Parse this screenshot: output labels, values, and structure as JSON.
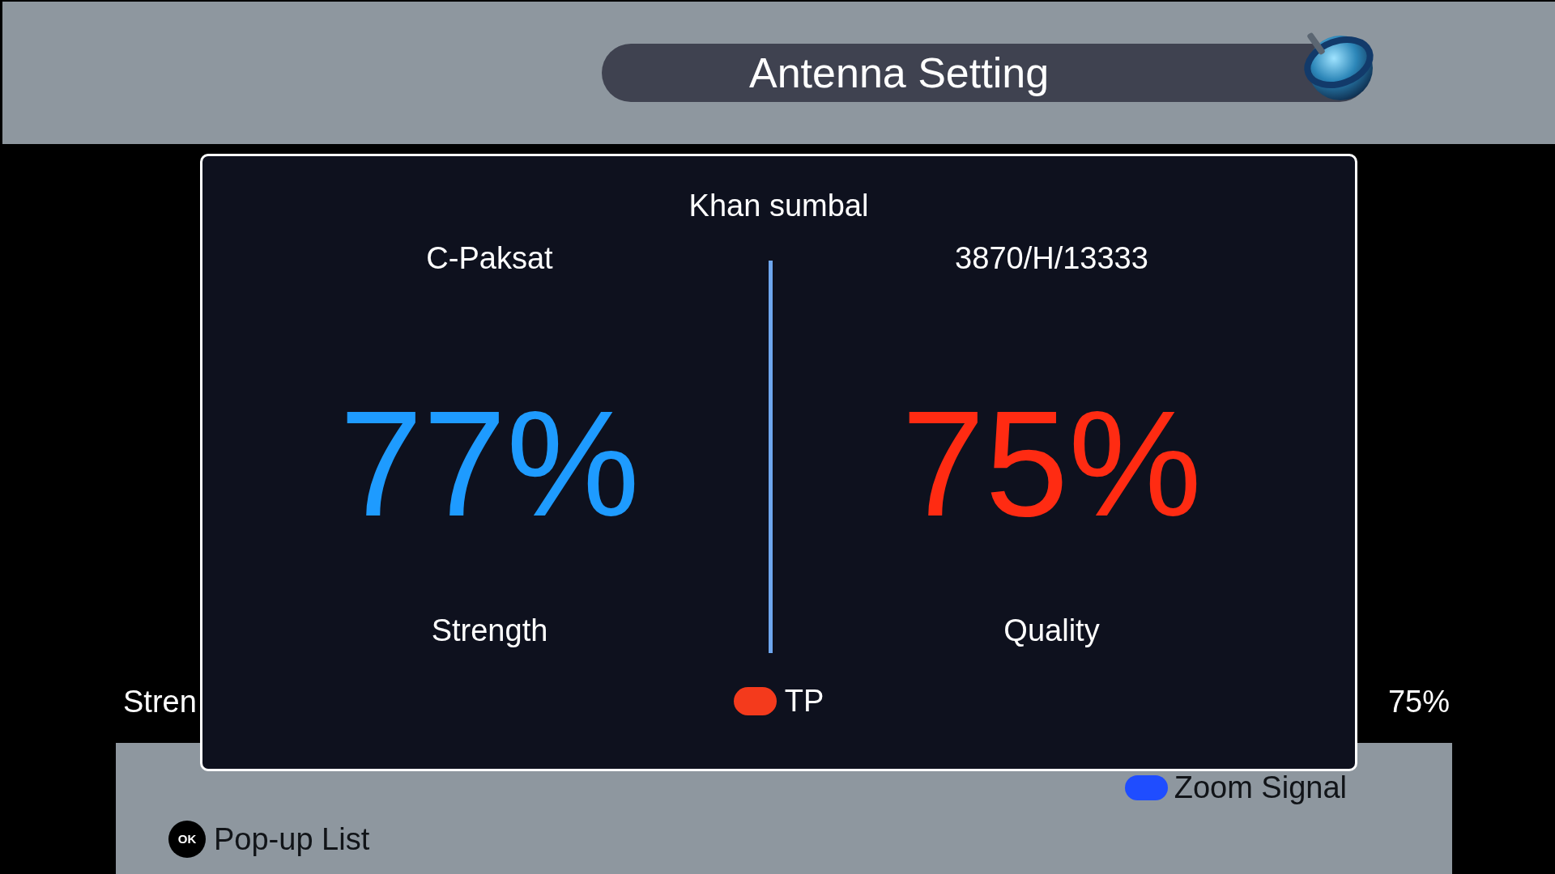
{
  "header": {
    "title": "Antenna Setting"
  },
  "background_row": {
    "label": "Stren",
    "reading": "75%"
  },
  "modal": {
    "title": "Khan sumbal",
    "meters": [
      {
        "caption": "C-Paksat",
        "value": "77%",
        "label": "Strength",
        "color": "#1e9bff"
      },
      {
        "caption": "3870/H/13333",
        "value": "75%",
        "label": "Quality",
        "color": "#ff2b12"
      }
    ],
    "hint": {
      "label": "TP",
      "color": "#f43a1c"
    }
  },
  "bottom_panel": {
    "hints": [
      {
        "kind": "color",
        "color": "#1f4dff",
        "label": "Zoom Signal"
      },
      {
        "kind": "key",
        "key": "OK",
        "label": "Pop-up List"
      }
    ]
  }
}
